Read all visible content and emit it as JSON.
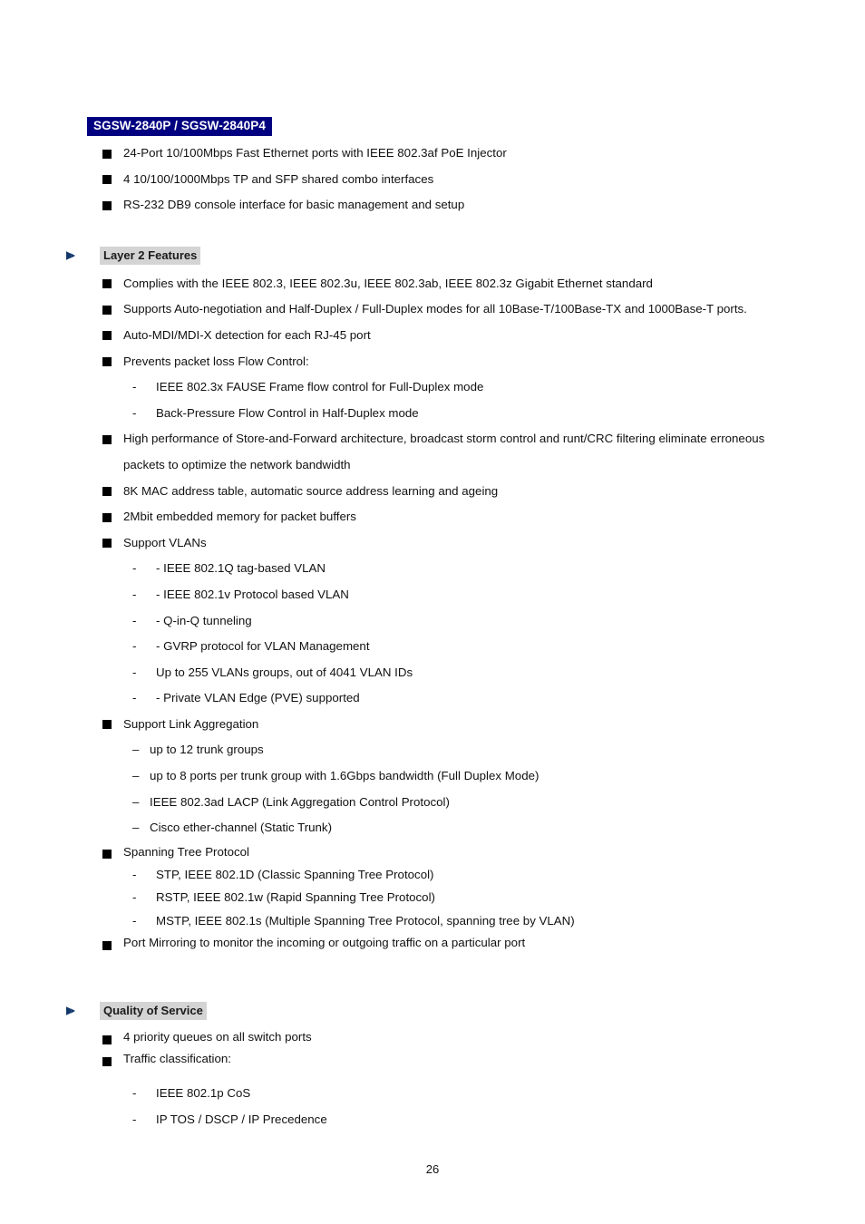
{
  "document": {
    "page_number": "26",
    "colors": {
      "title_band_bg": "#000080",
      "title_band_text": "#ffffff",
      "section_highlight_bg": "#d4d4d4",
      "triangle_bullet": "#12386b",
      "square_bullet": "#000000",
      "body_text": "#111111"
    }
  },
  "product_title": "SGSW-2840P / SGSW-2840P4",
  "intro_bullets": [
    "24-Port 10/100Mbps Fast Ethernet ports with IEEE 802.3af PoE Injector",
    "4 10/100/1000Mbps TP and SFP shared combo interfaces",
    "RS-232 DB9 console interface for basic management and setup"
  ],
  "sections": [
    {
      "id": "layer2",
      "heading": "Layer 2 Features",
      "items": [
        {
          "text": "Complies with the IEEE 802.3, IEEE 802.3u, IEEE 802.3ab, IEEE 802.3z Gigabit Ethernet standard"
        },
        {
          "text": "Supports Auto-negotiation and Half-Duplex / Full-Duplex modes for all 10Base-T/100Base-TX and 1000Base-T ports."
        },
        {
          "text": "Auto-MDI/MDI-X detection for each RJ-45 port"
        },
        {
          "text": "Prevents packet loss Flow Control:",
          "subitems": [
            "IEEE 802.3x FAUSE Frame flow control for Full-Duplex mode",
            "Back-Pressure Flow Control in Half-Duplex mode"
          ]
        },
        {
          "text": "High performance of Store-and-Forward architecture, broadcast storm control and runt/CRC filtering eliminate erroneous packets to optimize the network bandwidth"
        },
        {
          "text": "8K MAC address table, automatic source address learning and ageing"
        },
        {
          "text": "2Mbit embedded memory for packet buffers"
        },
        {
          "text": "Support VLANs",
          "subitems": [
            "- IEEE 802.1Q tag-based VLAN",
            "- IEEE 802.1v Protocol based VLAN",
            "- Q-in-Q tunneling",
            "- GVRP protocol for VLAN Management",
            "Up to 255 VLANs groups, out of 4041 VLAN IDs",
            "- Private VLAN Edge (PVE) supported"
          ]
        },
        {
          "text": "Support Link Aggregation",
          "subitems_dash": [
            "up to 12 trunk groups",
            "up to 8 ports per trunk group with 1.6Gbps bandwidth (Full Duplex Mode)",
            "IEEE 802.3ad LACP (Link Aggregation Control Protocol)",
            "Cisco ether-channel (Static Trunk)"
          ]
        },
        {
          "text": "Spanning Tree Protocol",
          "subitems": [
            "STP, IEEE 802.1D (Classic Spanning Tree Protocol)",
            "RSTP, IEEE 802.1w (Rapid Spanning Tree Protocol)",
            "MSTP, IEEE 802.1s (Multiple Spanning Tree Protocol, spanning tree by VLAN)"
          ]
        },
        {
          "text": "Port Mirroring to monitor the incoming or outgoing traffic on a particular port"
        }
      ]
    },
    {
      "id": "qos",
      "heading": "Quality of Service",
      "items": [
        {
          "text": "4 priority queues on all switch ports"
        },
        {
          "text": "Traffic classification:",
          "subitems": [
            "IEEE 802.1p CoS",
            "IP TOS / DSCP / IP Precedence"
          ]
        }
      ]
    }
  ],
  "markers": {
    "hyphen": "-",
    "endash": "–"
  }
}
